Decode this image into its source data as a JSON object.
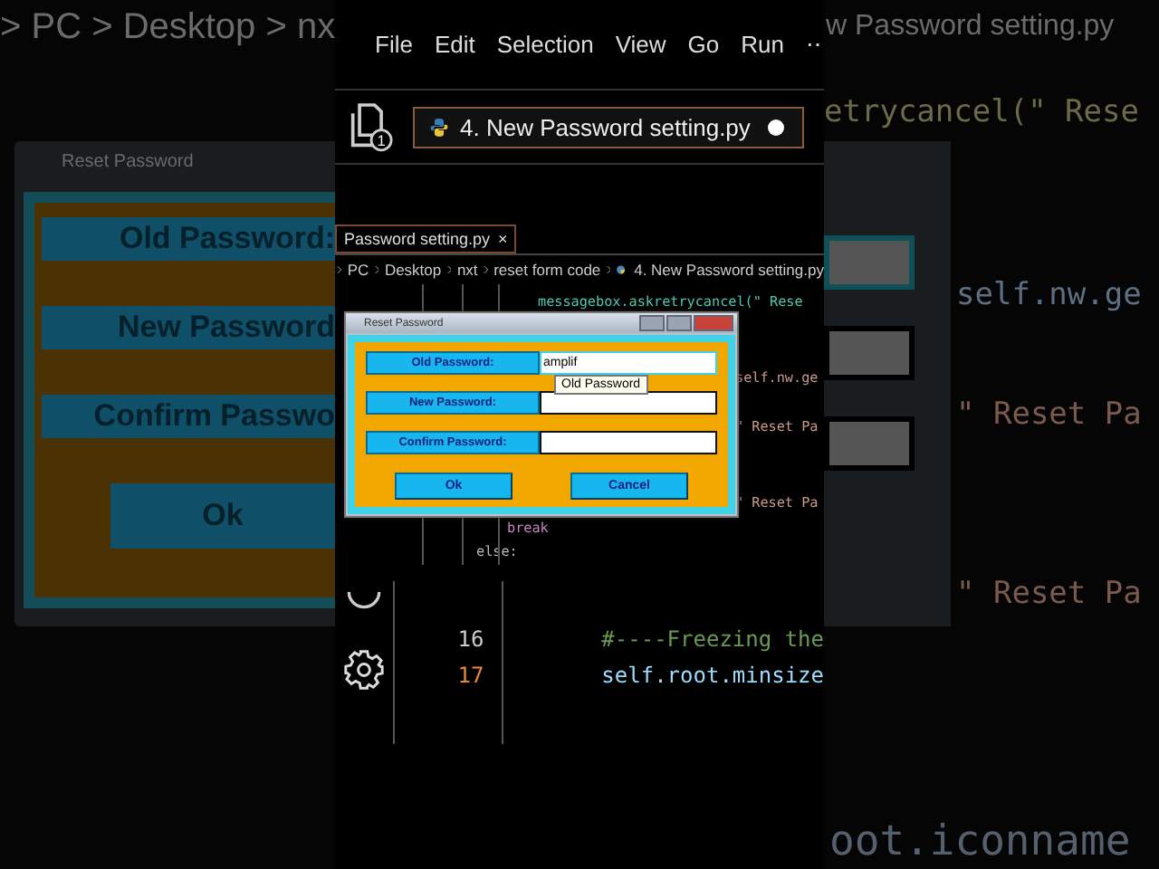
{
  "background": {
    "breadcrumb": "> PC > Desktop > nx",
    "tab_title": "w Password setting.py",
    "code_fragments": [
      {
        "kind": "call",
        "text": "etrycancel(\" Rese"
      },
      {
        "kind": "attr",
        "text": "self.nw.ge"
      },
      {
        "kind": "string",
        "text": "\" Reset Pa"
      },
      {
        "kind": "string",
        "text": "\" Reset Pa"
      }
    ],
    "bottom_code": "oot.iconname",
    "dialog": {
      "title": "Reset Password",
      "labels": [
        "Old Password:",
        "New Password",
        "Confirm Passwo"
      ],
      "button": "Ok"
    }
  },
  "editor": {
    "menu": [
      "File",
      "Edit",
      "Selection",
      "View",
      "Go",
      "Run",
      "⋯"
    ],
    "explorer_badge": "1",
    "tab": {
      "title": "4. New Password setting.py",
      "modified": true
    }
  },
  "inner": {
    "tab": {
      "title": "Password setting.py",
      "close": "×"
    },
    "breadcrumb": [
      "PC",
      "Desktop",
      "nxt",
      "reset form code",
      "4. New Password setting.py"
    ],
    "code": [
      {
        "kind": "innermost",
        "text": "messagebox.askretrycancel(\" Rese"
      },
      {
        "kind": "blank"
      },
      {
        "kind": "blank"
      },
      {
        "kind": "fragment",
        "text": "self.nw.ge"
      },
      {
        "kind": "blank"
      },
      {
        "kind": "fragment",
        "text": "\" Reset Pa"
      },
      {
        "kind": "blank"
      },
      {
        "kind": "blank"
      },
      {
        "kind": "fragment",
        "text": "\" Reset Pa"
      },
      {
        "kind": "inner",
        "text": "break"
      },
      {
        "kind": "outer",
        "text": "else:"
      }
    ]
  },
  "dialog": {
    "title": "Reset Password",
    "fields": [
      {
        "label": "Old Password:",
        "value": "amplif"
      },
      {
        "label": "New Password:"
      },
      {
        "label": "Confirm Password:"
      }
    ],
    "tooltip": "Old Password",
    "buttons": [
      "Ok",
      "Cancel"
    ]
  },
  "bottom_lines": [
    {
      "number": "16",
      "text": "#----Freezing the",
      "current": false,
      "kind": "comment"
    },
    {
      "number": "17",
      "text": "self.root.minsize",
      "current": true,
      "kind": "code"
    }
  ]
}
